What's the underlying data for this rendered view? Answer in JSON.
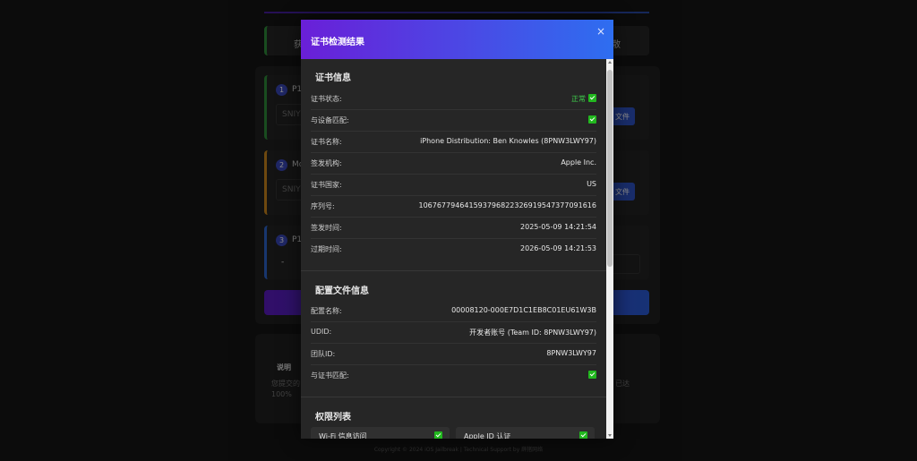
{
  "background": {
    "tab_left": "获",
    "tab_right": "散",
    "steps": [
      {
        "num": "1",
        "title": "P12",
        "input": "SNIYR",
        "button": "文件"
      },
      {
        "num": "2",
        "title": "Mo",
        "input": "SNIYR",
        "button": "文件"
      },
      {
        "num": "3",
        "title": "P12",
        "value": "-"
      }
    ],
    "notes_title": "说明",
    "notes_line1": "您提交的",
    "notes_line2": "100%",
    "notes_right": "已达"
  },
  "footer": "Copyright © 2024 iOS Jailbreak | Technical Support by 薛猪网络",
  "modal": {
    "title": "证书检测结果",
    "close": "×",
    "cert_section": {
      "title": "证书信息",
      "rows": [
        {
          "label": "证书状态:",
          "value": "正常",
          "check": true
        },
        {
          "label": "与设备匹配:",
          "value": "",
          "check": true
        },
        {
          "label": "证书名称:",
          "value": "iPhone Distribution: Ben Knowles (8PNW3LWY97)",
          "check": false
        },
        {
          "label": "签发机构:",
          "value": "Apple Inc.",
          "check": false
        },
        {
          "label": "证书国家:",
          "value": "US",
          "check": false
        },
        {
          "label": "序列号:",
          "value": "106767794641593796822326919547377091616",
          "check": false
        },
        {
          "label": "签发时间:",
          "value": "2025-05-09 14:21:54",
          "check": false
        },
        {
          "label": "过期时间:",
          "value": "2026-05-09 14:21:53",
          "check": false
        }
      ]
    },
    "profile_section": {
      "title": "配置文件信息",
      "rows": [
        {
          "label": "配置名称:",
          "value": "00008120-000E7D1C1EB8C01EU61W3B",
          "check": false
        },
        {
          "label": "UDID:",
          "value": "开发者账号 (Team ID: 8PNW3LWY97)",
          "check": false
        },
        {
          "label": "团队ID:",
          "value": "8PNW3LWY97",
          "check": false
        },
        {
          "label": "与证书匹配:",
          "value": "",
          "check": true
        }
      ]
    },
    "permissions_section": {
      "title": "权限列表",
      "items": [
        {
          "label": "Wi-Fi 信息访问",
          "check": true
        },
        {
          "label": "Apple ID 认证",
          "check": true
        }
      ]
    }
  }
}
